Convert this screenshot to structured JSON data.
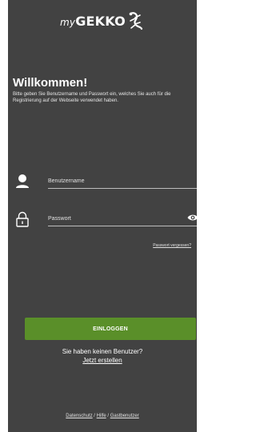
{
  "logo": {
    "prefix": "my",
    "brand": "GEKKO"
  },
  "welcome": {
    "title": "Willkommen!",
    "text": "Bitte geben Sie Benutzername und Passwort ein, welches Sie auch für die Registrierung auf der Webseite verwendet haben."
  },
  "username": {
    "placeholder": "Benutzername",
    "value": ""
  },
  "password": {
    "placeholder": "Passwort",
    "value": ""
  },
  "forgot_password": "Passwort vergessen?",
  "login_button": "EINLOGGEN",
  "no_user_text": "Sie haben keinen Benutzer?",
  "create_link": "Jetzt erstellen",
  "footer": {
    "privacy": "Datenschutz",
    "help": "Hilfe",
    "guest": "Gastbenutzer",
    "separator": " / "
  },
  "colors": {
    "background": "#424242",
    "accent": "#5a8f29",
    "text": "#ffffff"
  }
}
